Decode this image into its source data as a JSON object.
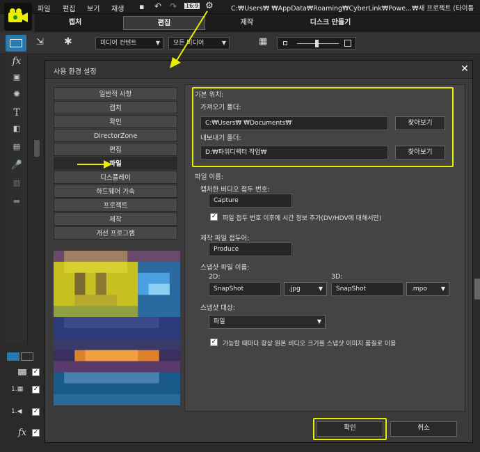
{
  "menubar": {
    "items": [
      "파일",
      "편집",
      "보기",
      "재생"
    ],
    "path": "C:₩Users₩           ₩AppData₩Roaming₩CyberLink₩Powe...₩새 프로젝트 (타이틀"
  },
  "mode_tabs": [
    "캡처",
    "편집",
    "제작",
    "디스크 만들기"
  ],
  "toolbar": {
    "media_dd": "미디어 컨텐트",
    "filter_dd": "모든 미디어"
  },
  "dialog": {
    "title": "사용 환경 설정",
    "close": "✕",
    "categories": [
      "일반적 사항",
      "캡처",
      "확인",
      "DirectorZone",
      "편집",
      "파일",
      "디스플레이",
      "하드웨어 가속",
      "프로젝트",
      "제작",
      "개선 프로그램"
    ],
    "selected_category_index": 5,
    "default_location": {
      "section": "기본 위치:",
      "import_label": "가져오기 폴더:",
      "import_value": "C:₩Users₩         ₩Documents₩",
      "export_label": "내보내기 폴더:",
      "export_value": "D:₩파워디렉터 작업₩",
      "browse": "찾아보기"
    },
    "file_name": {
      "section": "파일 이름:",
      "capture_label": "캡처한 비디오 접두 번호:",
      "capture_value": "Capture",
      "timecode_check": "파일 접두 번호 이후에 시간 정보 추가(DV/HDV에 대해서만)",
      "produce_label": "제작 파일 접두어:",
      "produce_value": "Produce",
      "snapshot_label": "스냅샷 파일 이름:",
      "snap2d_label": "2D:",
      "snap2d_value": "SnapShot",
      "snap2d_ext": ".jpg",
      "snap3d_label": "3D:",
      "snap3d_value": "SnapShot",
      "snap3d_ext": ".mpo",
      "target_label": "스냅샷 대상:",
      "target_value": "파일",
      "orig_size_check": "가능할 때마다 항상 원본 비디오 크기를 스냅샷 이미지 품질로 이용"
    },
    "ok": "확인",
    "cancel": "취소"
  },
  "colors": {
    "highlight": "#e8f000",
    "accent": "#4a90e2"
  }
}
